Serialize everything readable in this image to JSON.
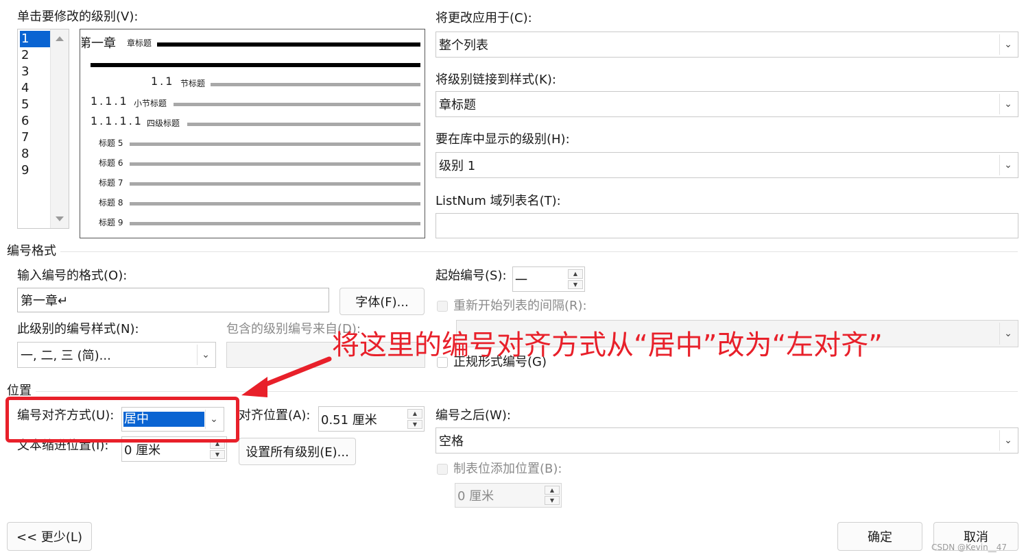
{
  "level_select": {
    "label": "单击要修改的级别(V):",
    "levels": [
      "1",
      "2",
      "3",
      "4",
      "5",
      "6",
      "7",
      "8",
      "9"
    ],
    "selected": "1"
  },
  "preview": {
    "chapter_number": "第一章",
    "chapter_style": "章标题",
    "level2_number": "1.1",
    "level2_style": "节标题",
    "level3_number": "1.1.1",
    "level3_style": "小节标题",
    "level4_number": "1.1.1.1",
    "level4_style": "四级标题",
    "heading5": "标题 5",
    "heading6": "标题 6",
    "heading7": "标题 7",
    "heading8": "标题 8",
    "heading9": "标题 9"
  },
  "apply_to": {
    "label": "将更改应用于(C):",
    "value": "整个列表"
  },
  "link_style": {
    "label": "将级别链接到样式(K):",
    "value": "章标题"
  },
  "gallery_level": {
    "label": "要在库中显示的级别(H):",
    "value": "级别 1"
  },
  "listnum": {
    "label": "ListNum 域列表名(T):",
    "value": ""
  },
  "number_format": {
    "section_title": "编号格式",
    "format_label": "输入编号的格式(O):",
    "format_value": "第一章↵",
    "font_button": "字体(F)...",
    "style_label": "此级别的编号样式(N):",
    "style_value": "一, 二, 三 (简)...",
    "include_label": "包含的级别编号来自(D):",
    "include_value": "",
    "start_label": "起始编号(S):",
    "start_value": "一",
    "restart_label": "重新开始列表的间隔(R):",
    "restart_value": "",
    "legal_label": "正规形式编号(G)"
  },
  "position": {
    "section_title": "位置",
    "align_label": "编号对齐方式(U):",
    "align_value": "居中",
    "align_at_label": "对齐位置(A):",
    "align_at_value": "0.51 厘米",
    "indent_label": "文本缩进位置(I):",
    "indent_value": "0 厘米",
    "set_all_button": "设置所有级别(E)...",
    "follow_label": "编号之后(W):",
    "follow_value": "空格",
    "tab_label": "制表位添加位置(B):",
    "tab_value": "0 厘米"
  },
  "footer": {
    "less_button": "<< 更少(L)",
    "ok_button": "确定",
    "cancel_button": "取消",
    "watermark": "CSDN @Kevin__47"
  },
  "annotation": {
    "text": "将这里的编号对齐方式从“居中”改为“左对齐”",
    "color": "#e8202a"
  },
  "colors": {
    "selection": "#0a64d2",
    "annotation_red": "#e8202a"
  }
}
